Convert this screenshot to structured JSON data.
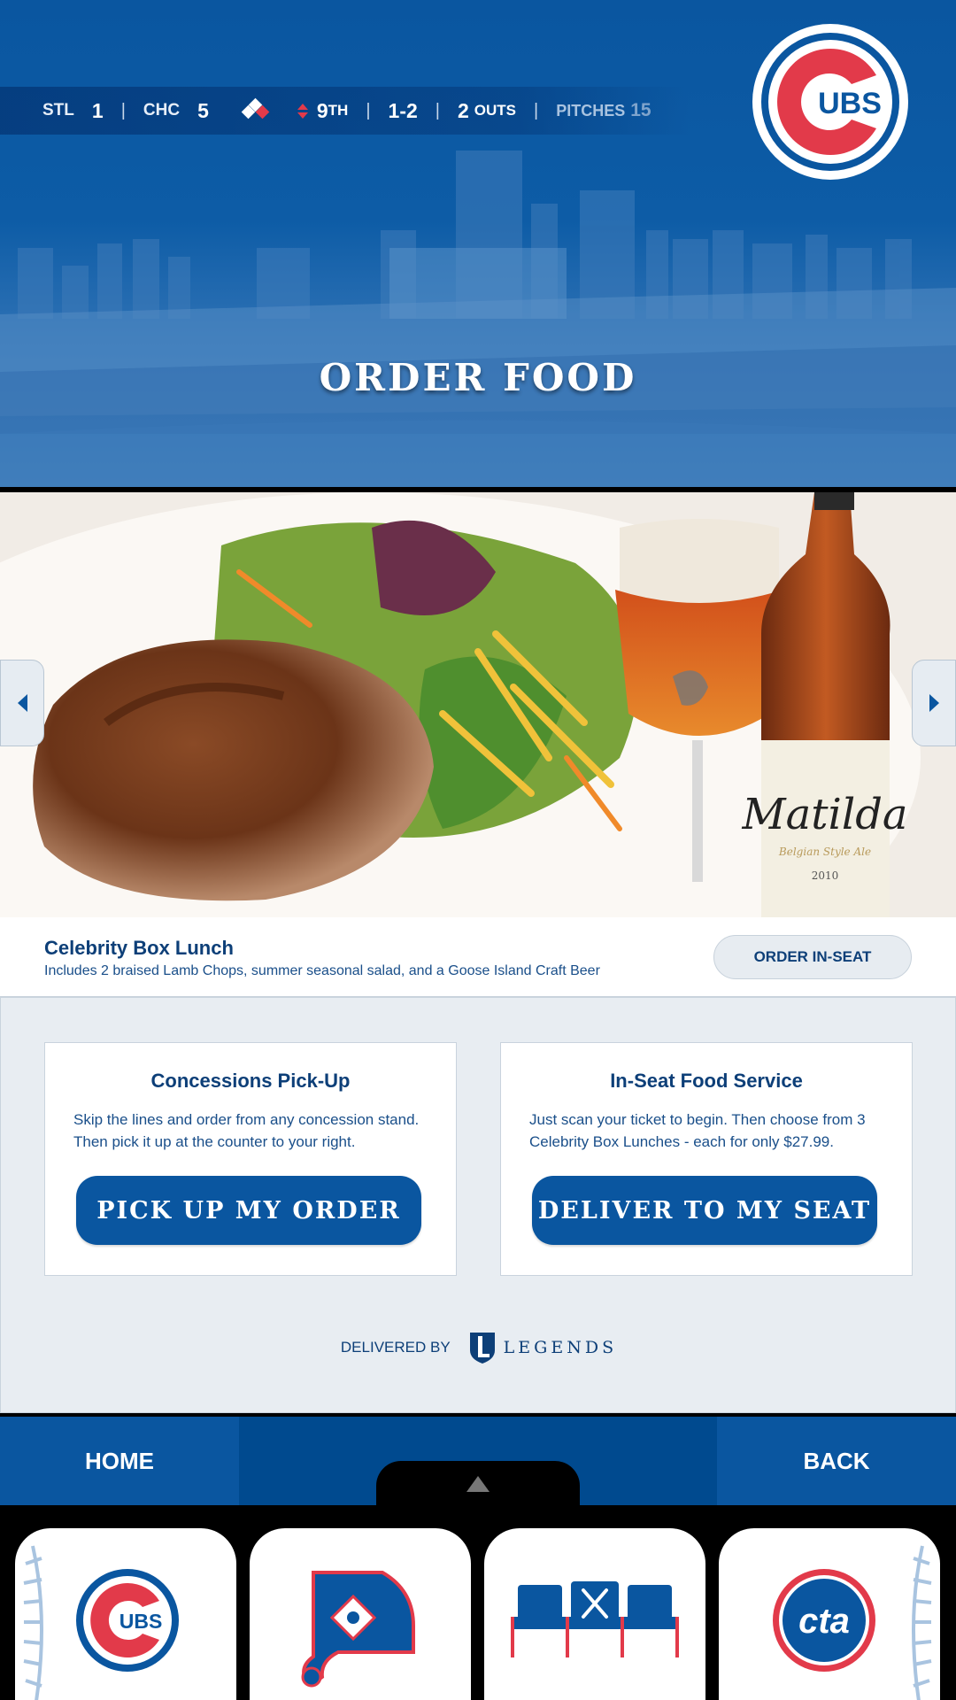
{
  "scoreboard": {
    "away_team": "STL",
    "away_score": "1",
    "home_team": "CHC",
    "home_score": "5",
    "inning_num": "9",
    "inning_suffix": "TH",
    "count": "1-2",
    "outs_num": "2",
    "outs_label": "OUTS",
    "pitches_label": "PITCHES",
    "pitches_value": "15",
    "separator": "|"
  },
  "logo_text": "UBS",
  "hero": {
    "title": "ORDER FOOD"
  },
  "featured": {
    "bottle_label": "Matilda",
    "bottle_sublabel": "Belgian Style Ale",
    "bottle_year": "2010",
    "item_name": "Celebrity Box Lunch",
    "item_description": "Includes 2 braised Lamb Chops, summer seasonal salad, and a Goose Island Craft Beer",
    "order_button": "ORDER IN-SEAT"
  },
  "options": {
    "pickup": {
      "title": "Concessions Pick-Up",
      "text": "Skip the lines and order from any concession stand. Then pick it up at the counter to your right.",
      "button": "PICK UP MY ORDER"
    },
    "inseat": {
      "title": "In-Seat Food Service",
      "text": "Just scan your ticket to begin. Then choose from 3 Celebrity Box Lunches - each for only $27.99.",
      "button": "DELIVER TO MY SEAT"
    }
  },
  "delivered_by": {
    "label": "DELIVERED BY",
    "brand": "LEGENDS"
  },
  "nav": {
    "home": "HOME",
    "back": "BACK"
  },
  "drawer": {
    "tiles": [
      {
        "icon": "cubs-logo-icon",
        "text": "UBS"
      },
      {
        "icon": "ballpark-map-icon"
      },
      {
        "icon": "food-seat-icon"
      },
      {
        "icon": "cta-logo-icon",
        "text": "cta"
      }
    ]
  },
  "colors": {
    "primary_blue": "#0a56a0",
    "dark_navy": "#0d3f78",
    "cubs_red": "#e23a4a",
    "panel_bg": "#e8edf2"
  }
}
